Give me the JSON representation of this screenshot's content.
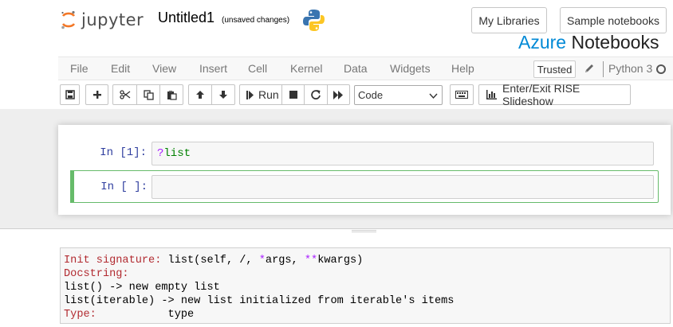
{
  "header": {
    "logo_text": "jupyter",
    "notebook_title": "Untitled1",
    "save_status": "(unsaved changes)",
    "buttons": {
      "my_libraries": "My Libraries",
      "sample_notebooks": "Sample notebooks"
    },
    "brand": {
      "azure": "Azure",
      "notebooks": "Notebooks"
    },
    "colors": {
      "jupyter_orange": "#f37726",
      "azure_blue": "#0089d6"
    }
  },
  "menubar": {
    "items": [
      "File",
      "Edit",
      "View",
      "Insert",
      "Cell",
      "Kernel",
      "Data",
      "Widgets",
      "Help"
    ],
    "trusted": "Trusted",
    "kernel": "Python 3",
    "icons": {
      "edit": "pencil-icon",
      "kernel_status": "circle-icon"
    }
  },
  "toolbar": {
    "run_label": "Run",
    "cell_type": "Code",
    "rise_label": "Enter/Exit RISE Slideshow",
    "icons": [
      "save-icon",
      "plus-icon",
      "cut-icon",
      "copy-icon",
      "paste-icon",
      "arrow-up-icon",
      "arrow-down-icon",
      "step-forward-icon",
      "stop-icon",
      "restart-icon",
      "fast-forward-icon",
      "keyboard-icon",
      "bar-chart-icon"
    ]
  },
  "cells": [
    {
      "prompt": "In [1]:",
      "code_op": "?",
      "code_name": "list"
    },
    {
      "prompt": "In [ ]:",
      "code": ""
    }
  ],
  "pager": {
    "init_label": "Init signature:",
    "init_value_1": " list(self, /, ",
    "init_star": "*",
    "init_args": "args, ",
    "init_dstar": "**",
    "init_kwargs": "kwargs)",
    "doc_label": "Docstring:",
    "doc_line_1": "list() -> new empty list",
    "doc_line_2": "list(iterable) -> new list initialized from iterable's items",
    "type_label": "Type:",
    "type_value": "           type"
  }
}
